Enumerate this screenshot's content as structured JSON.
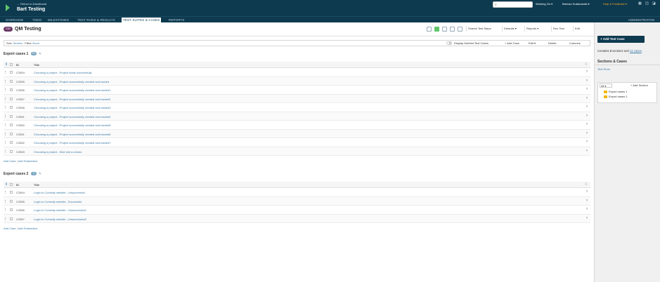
{
  "header": {
    "return_link": "← Return to Dashboard",
    "project_title": "Bart Testing",
    "search_placeholder": "",
    "working_on": "Working On ▾",
    "user": "Bartosz Kulawowski ▾",
    "help": "Help & Feedback ▾"
  },
  "nav": {
    "tabs": [
      "OVERVIEW",
      "TODO",
      "MILESTONES",
      "TEST RUNS & RESULTS",
      "TEST SUITES & CASES",
      "REPORTS"
    ],
    "active_index": 4,
    "administration": "ADMINISTRATION"
  },
  "page": {
    "badge": "S30",
    "title": "QM Testing",
    "toolbar": {
      "shared_test_steps": "Shared Test Steps",
      "defaults": "Defaults ▾",
      "reports": "Reports ▾",
      "run_test": "Run Test",
      "edit": "Edit"
    }
  },
  "filter": {
    "sort_label": "Sort:",
    "sort_value": "Section",
    "filter_label": "Filter:",
    "filter_value": "None",
    "display_deleted": "Display Deleted Test Cases",
    "add_case": "+ Add Case",
    "edit": "Edit ▾",
    "delete": "Delete",
    "columns": "Columns"
  },
  "sections": [
    {
      "title": "Export cases 1",
      "count": "10",
      "header": {
        "id": "ID",
        "title": "Title"
      },
      "rows": [
        {
          "id": "C2554",
          "title": "Choosing a project...Project loads successfully"
        },
        {
          "id": "C2555",
          "title": "Choosing a project...Project successfully created and loaded"
        },
        {
          "id": "C2556",
          "title": "Choosing a project...Project successfully created and loaded1"
        },
        {
          "id": "C2557",
          "title": "Choosing a project...Project successfully created and loaded2"
        },
        {
          "id": "C2558",
          "title": "Choosing a project...Project successfully created and loaded3"
        },
        {
          "id": "C2561",
          "title": "Choosing a project...Project successfully created and loaded4"
        },
        {
          "id": "C2560",
          "title": "Choosing a project...Project successfully created and loaded5"
        },
        {
          "id": "C2561",
          "title": "Choosing a project...Project successfully created and loaded6"
        },
        {
          "id": "C2562",
          "title": "Choosing a project...Project successfully created and loaded7"
        },
        {
          "id": "C2563",
          "title": "Choosing a project...Side menu closes"
        }
      ],
      "links": {
        "add_case": "Add Case",
        "add_subsection": "Add Subsection"
      }
    },
    {
      "title": "Export cases 2",
      "count": "4",
      "header": {
        "id": "ID",
        "title": "Title"
      },
      "rows": [
        {
          "id": "C2564",
          "title": "Login to Curiosity website...Unsuccessful"
        },
        {
          "id": "C2565",
          "title": "Login to Curiosity website...Successful"
        },
        {
          "id": "C2566",
          "title": "Login to Curiosity website...Unsuccessful1"
        },
        {
          "id": "C2567",
          "title": "Login to Curiosity website...Unsuccessful2"
        }
      ],
      "links": {
        "add_case": "Add Case",
        "add_subsection": "Add Subsection"
      }
    }
  ],
  "sidebar": {
    "add_test_case": "+ Add Test Case",
    "contains_prefix": "Contains",
    "contains_sections": "2",
    "contains_mid": "sections and",
    "contains_cases": "14 cases",
    "contains_suffix": ".",
    "sections_heading": "Sections & Cases",
    "test_runs": "Test Runs",
    "tree_all": "All ▾",
    "add_section": "+ Add Section",
    "tree_items": [
      "Export cases 1",
      "Export cases 2"
    ]
  }
}
